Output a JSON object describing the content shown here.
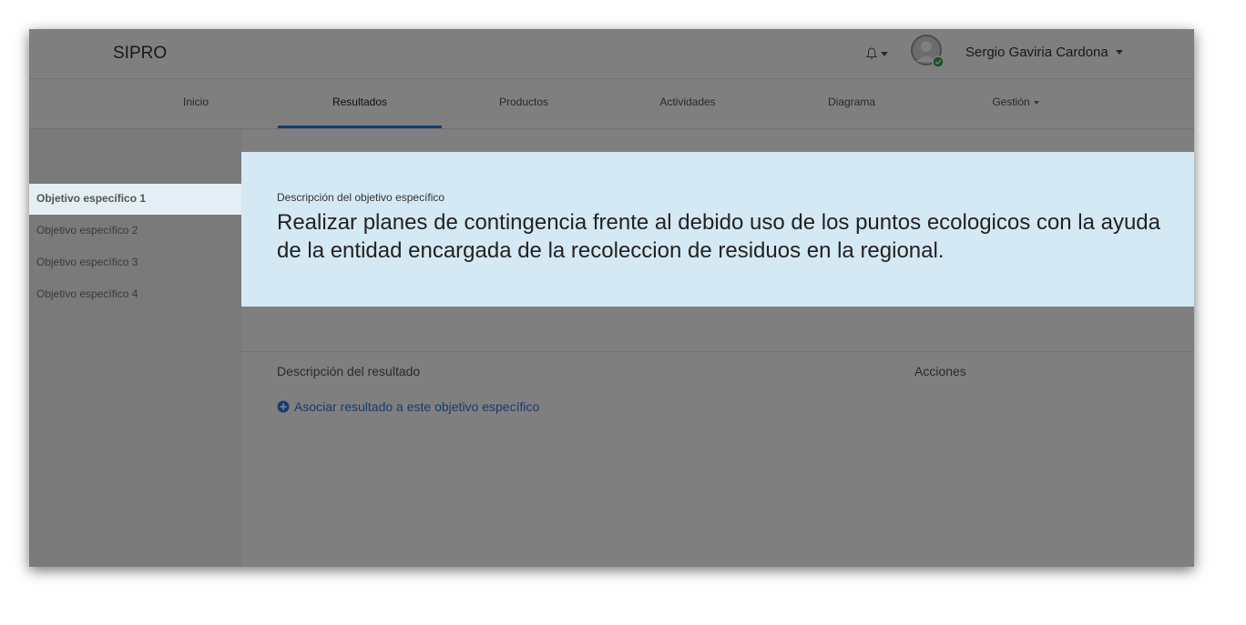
{
  "app": {
    "brand": "SIPRO"
  },
  "header": {
    "user_name": "Sergio Gaviria Cardona",
    "bell_icon": "bell-icon",
    "avatar_icon": "avatar-icon",
    "status_color": "#2fa84f"
  },
  "menu": {
    "items": [
      {
        "label": "Inicio"
      },
      {
        "label": "Resultados"
      },
      {
        "label": "Productos"
      },
      {
        "label": "Actividades"
      },
      {
        "label": "Diagrama"
      },
      {
        "label": "Gestión"
      }
    ],
    "active": "Resultados",
    "accent": "#2a7ae2"
  },
  "sidebar": {
    "items": [
      {
        "label": "Objetivo específico 1"
      },
      {
        "label": "Objetivo específico 2"
      },
      {
        "label": "Objetivo específico 3"
      },
      {
        "label": "Objetivo específico 4"
      }
    ]
  },
  "highlight": {
    "label": "Descripción del objetivo específico",
    "text": "Realizar planes de contingencia frente al debido uso de los puntos ecologicos con la ayuda de la entidad encargada de la recoleccion de residuos en la regional.",
    "background": "#d5e9f4"
  },
  "table": {
    "col_description": "Descripción del resultado",
    "col_actions": "Acciones"
  },
  "link": {
    "label": "Asociar resultado a este objetivo específico",
    "icon": "plus-circle-icon"
  }
}
